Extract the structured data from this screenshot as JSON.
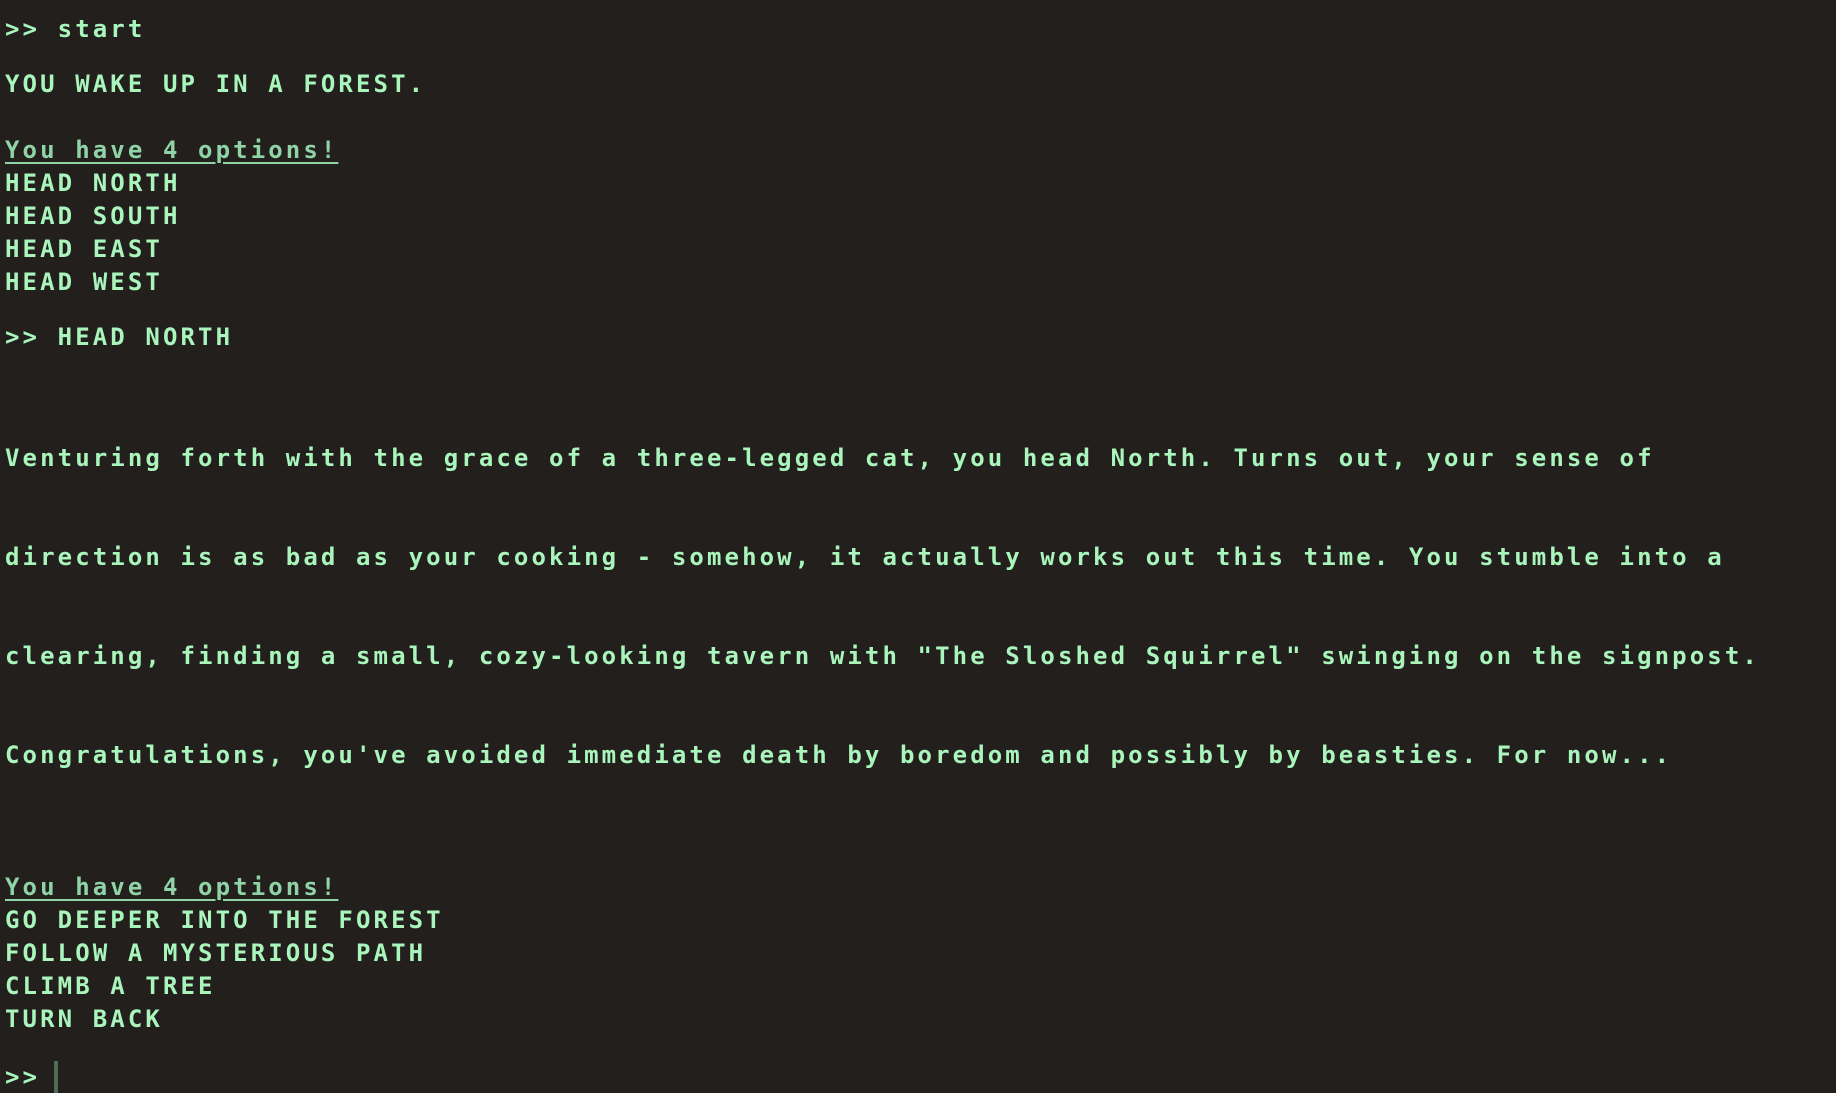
{
  "terminal": {
    "first_command": ">> start",
    "intro_text": "YOU WAKE UP IN A FOREST.",
    "options_header_1": "You have 4 options!",
    "options_1": [
      "HEAD NORTH",
      "HEAD SOUTH",
      "HEAD EAST",
      "HEAD WEST"
    ],
    "second_command": ">> HEAD NORTH",
    "story_lines": [
      "Venturing forth with the grace of a three-legged cat, you head North. Turns out, your sense of",
      "direction is as bad as your cooking - somehow, it actually works out this time. You stumble into a",
      "clearing, finding a small, cozy-looking tavern with \"The Sloshed Squirrel\" swinging on the signpost.",
      "Congratulations, you've avoided immediate death by boredom and possibly by beasties. For now..."
    ],
    "options_header_2": "You have 4 options!",
    "options_2": [
      "GO DEEPER INTO THE FOREST",
      "FOLLOW A MYSTERIOUS PATH",
      "CLIMB A TREE",
      "TURN BACK"
    ],
    "prompt_symbol": ">>",
    "input_value": ""
  },
  "colors": {
    "background": "#221f1d",
    "text": "#a9f5bc",
    "underline_text": "#8fd3a6",
    "cursor": "#4e6b56"
  }
}
